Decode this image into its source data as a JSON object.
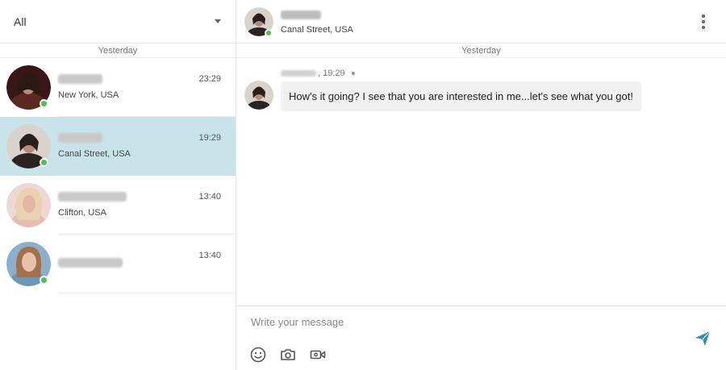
{
  "filter": {
    "label": "All",
    "icon": "chevron-down-icon"
  },
  "sidebar": {
    "day_separator": "Yesterday",
    "conversations": [
      {
        "location": "New York, USA",
        "time": "23:29",
        "online": true
      },
      {
        "location": "Canal Street, USA",
        "time": "19:29",
        "online": true,
        "active": true
      },
      {
        "location": "Clifton, USA",
        "time": "13:40",
        "online": false
      },
      {
        "location": "",
        "time": "13:40",
        "online": true
      }
    ]
  },
  "chat": {
    "header": {
      "location": "Canal Street, USA",
      "menu_icon": "more-vertical-icon"
    },
    "day_separator": "Yesterday",
    "message": {
      "time": ", 19:29",
      "text": "How's it going? I see that you are interested in me...let's see what you got!"
    },
    "composer": {
      "placeholder": "Write your message",
      "value": "",
      "tools": [
        "emoji-icon",
        "camera-icon",
        "video-camera-icon"
      ],
      "send_icon": "send-icon"
    }
  },
  "colors": {
    "active_row": "#c8e4ea",
    "online": "#4fc14f",
    "send": "#2f8fa3"
  }
}
